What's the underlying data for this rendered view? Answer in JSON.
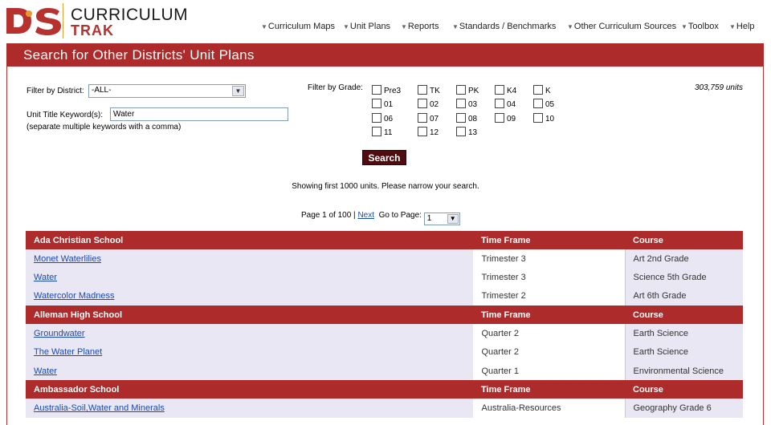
{
  "header": {
    "brand_top": "CURRICULUM",
    "brand_bottom": "TRAK",
    "nav": [
      {
        "label": "Curriculum Maps"
      },
      {
        "label": "Unit Plans"
      },
      {
        "label": "Reports"
      },
      {
        "label": "Standards / Benchmarks"
      },
      {
        "label": "Other Curriculum Sources"
      },
      {
        "label": "Toolbox"
      },
      {
        "label": "Help"
      }
    ],
    "caret": "▼"
  },
  "page_title": "Search for Other Districts' Unit Plans",
  "filters": {
    "district_label": "Filter by District:",
    "district_value": "-ALL-",
    "keyword_label": "Unit Title Keyword(s):",
    "keyword_value": "Water",
    "keyword_hint": "(separate multiple keywords with a comma)",
    "grade_label": "Filter by Grade:",
    "grades": [
      "Pre3",
      "TK",
      "PK",
      "K4",
      "K",
      "01",
      "02",
      "03",
      "04",
      "05",
      "06",
      "07",
      "08",
      "09",
      "10",
      "11",
      "12",
      "13"
    ],
    "units_count": "303,759 units"
  },
  "search_button": "Search",
  "showing_text": "Showing first 1000 units. Please narrow your search.",
  "pager": {
    "page_text": "Page 1 of 100 |",
    "next": "Next",
    "goto_label": "Go to Page:",
    "goto_value": "1"
  },
  "table": {
    "header_timeframe": "Time Frame",
    "header_course": "Course",
    "schools": [
      {
        "name": "Ada Christian School",
        "units": [
          {
            "title": "Monet Waterlilies",
            "timeframe": "Trimester 3",
            "course": "Art 2nd Grade"
          },
          {
            "title": "Water",
            "timeframe": "Trimester 3",
            "course": "Science 5th Grade"
          },
          {
            "title": "Watercolor Madness",
            "timeframe": "Trimester 2",
            "course": "Art 6th Grade"
          }
        ]
      },
      {
        "name": "Alleman High School",
        "units": [
          {
            "title": "Groundwater",
            "timeframe": "Quarter 2",
            "course": "Earth Science"
          },
          {
            "title": "The Water Planet",
            "timeframe": "Quarter 2",
            "course": "Earth Science"
          },
          {
            "title": "Water",
            "timeframe": "Quarter 1",
            "course": "Environmental Science"
          }
        ]
      },
      {
        "name": "Ambassador School",
        "units": [
          {
            "title": "Australia-Soil,Water and Minerals",
            "timeframe": "Australia-Resources",
            "course": "Geography Grade 6"
          }
        ]
      }
    ]
  },
  "colors": {
    "brand_red": "#ad2b2a",
    "search_button": "#4e0c10",
    "link_blue": "#1a4ab4",
    "row_lavender": "#e9e7f4"
  }
}
